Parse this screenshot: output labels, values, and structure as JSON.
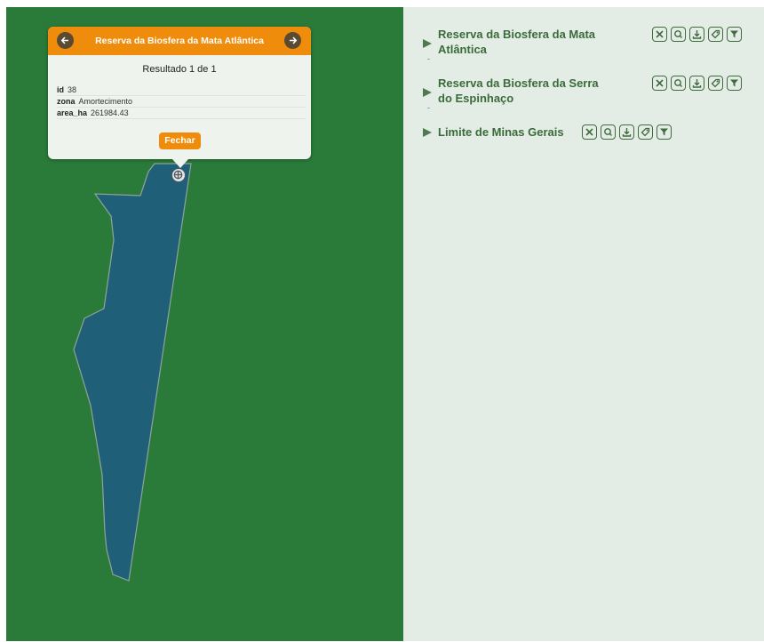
{
  "popup": {
    "title": "Reserva da Biosfera da Mata Atlântica",
    "result": "Resultado 1 de 1",
    "attributes": [
      {
        "key": "id",
        "value": "38"
      },
      {
        "key": "zona",
        "value": "Amortecimento"
      },
      {
        "key": "area_ha",
        "value": "261984.43"
      }
    ],
    "close_label": "Fechar"
  },
  "layers": [
    {
      "name": "Reserva da Biosfera da Mata Atlântica"
    },
    {
      "name": "Reserva da Biosfera da Serra do Espinhaço"
    },
    {
      "name": "Limite de Minas Gerais"
    }
  ],
  "colors": {
    "map_background": "#2a7b3a",
    "polygon_fill": "#1f6078",
    "panel_background": "#e4ede5",
    "popup_accent": "#f08c0b",
    "layer_text": "#3a6b3a"
  },
  "icons": {
    "tools": [
      "close-icon",
      "zoom-icon",
      "download-icon",
      "tag-icon",
      "filter-icon"
    ]
  }
}
